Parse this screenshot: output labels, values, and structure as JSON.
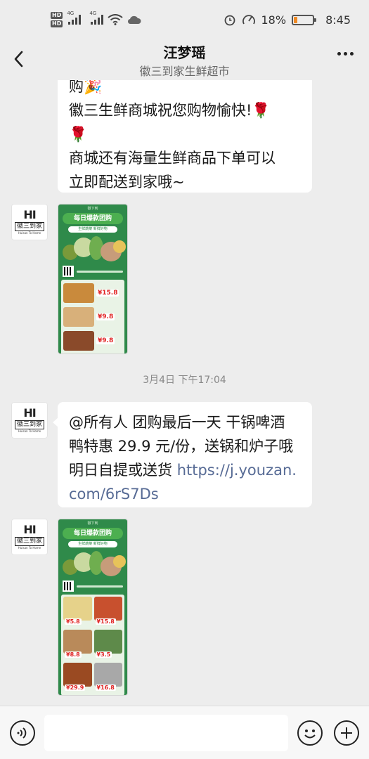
{
  "status_bar": {
    "hd1": "HD",
    "hd2": "HD",
    "net1": "4G",
    "net2": "4G",
    "battery_percent": "18%",
    "battery_level": 0.18,
    "battery_color": "#f08a24",
    "time": "8:45"
  },
  "nav": {
    "title": "汪梦瑶",
    "subtitle": "徽三到家生鲜超市",
    "back_icon": "chevron-left-icon",
    "more_icon": "more-dots-icon"
  },
  "messages": {
    "msg1_lines": [
      "购🎉",
      "徽三生鲜商城祝您购物愉快!🌹",
      "🌹",
      "商城还有海量生鲜商品下单可以",
      "立即配送到家哦~"
    ],
    "time_label": "3月4日 下午17:04",
    "msg3_lines": [
      "@所有人 团购最后一天 干锅啤酒",
      "鸭特惠 29.9 元/份，送锅和炉子哦",
      "明日自提或送货 "
    ],
    "msg3_link_part1": "https://j.youzan.",
    "msg3_link_part2": "com/6rS7Ds"
  },
  "avatar": {
    "logo_mark": "HI",
    "logo_text": "徽三到家",
    "logo_en": "Huisan To Home"
  },
  "poster": {
    "top": "徽下到",
    "banner": "每日爆款团购",
    "sub": "生鲜蔬菜 新鲜好物",
    "prices_list": [
      "¥15.8",
      "¥9.8",
      "¥9.8"
    ],
    "prices_grid": [
      "¥5.8",
      "¥15.8",
      "¥8.8",
      "¥3.5",
      "¥29.9",
      "¥16.8"
    ]
  },
  "input_bar": {
    "voice_icon": "voice-icon",
    "emoji_icon": "emoji-icon",
    "plus_icon": "plus-icon"
  }
}
